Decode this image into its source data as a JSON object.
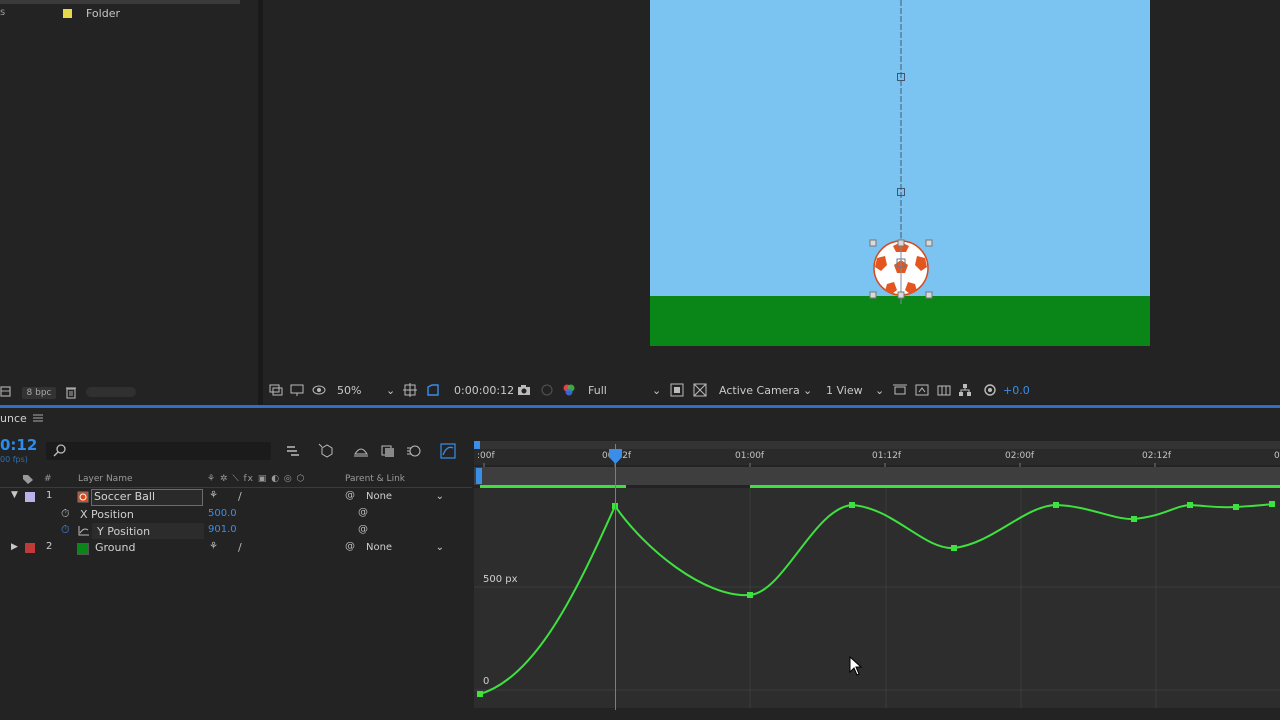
{
  "project": {
    "folder_prefix": "s",
    "folder_label": "Folder",
    "bpc": "8 bpc"
  },
  "viewer": {
    "zoom": "50%",
    "timecode": "0:00:00:12",
    "resolution": "Full",
    "camera": "Active Camera",
    "views": "1 View",
    "exposure": "+0.0"
  },
  "timeline": {
    "comp_tab": "unce",
    "timecode": "0:12",
    "fps": "00 fps)",
    "columns": {
      "num": "#",
      "layer_name": "Layer Name",
      "parent": "Parent & Link"
    },
    "layers": [
      {
        "index": "1",
        "name": "Soccer Ball",
        "parent": "None",
        "color": "#b7b3e8",
        "properties": [
          {
            "name": "X Position",
            "value": "500.0"
          },
          {
            "name": "Y Position",
            "value": "901.0"
          }
        ]
      },
      {
        "index": "2",
        "name": "Ground",
        "parent": "None",
        "color": "#c03a3a"
      }
    ]
  },
  "graph_editor": {
    "ruler_labels": [
      ":00f",
      "00:12f",
      "01:00f",
      "01:12f",
      "02:00f",
      "02:12f",
      "0"
    ],
    "y_labels": [
      "500 px",
      "0"
    ],
    "curve_color": "#3ee23e"
  }
}
